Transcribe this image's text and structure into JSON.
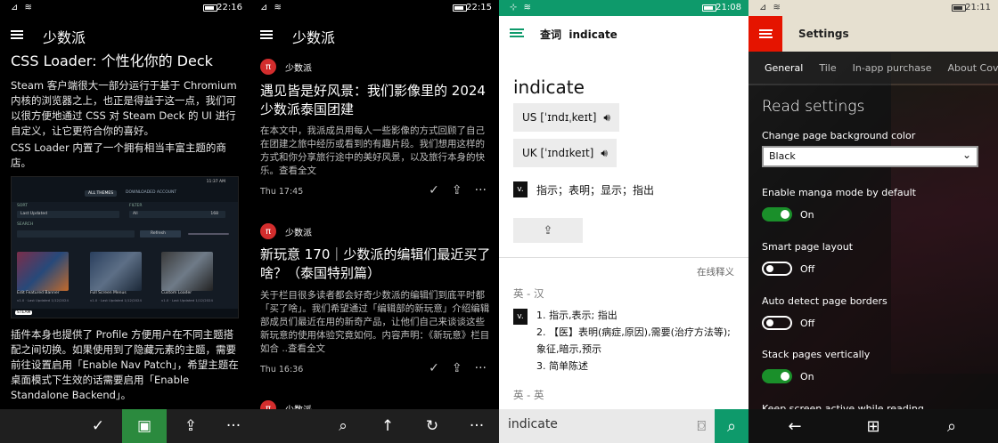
{
  "panel1": {
    "status": {
      "signal": "⊿ ≋",
      "time": "22:16"
    },
    "header": {
      "title": "少数派"
    },
    "article": {
      "title": "CSS Loader: 个性化你的 Deck",
      "p1": "Steam 客户端很大一部分运行于基于 Chromium 内核的浏览器之上，也正是得益于这一点，我们可以很方便地通过 CSS 对 Steam Deck 的 UI 进行自定义，让它更符合你的喜好。",
      "p2": "CSS Loader 内置了一个拥有相当丰富主题的商店。",
      "p3": "插件本身也提供了 Profile 方便用户在不同主题搭配之间切换。如果使用到了隐藏元素的主题，需要前往设置启用「Enable Nav Patch」，希望主题在桌面模式下生效的话需要启用「Enable Standalone Backend」。"
    },
    "screenshot": {
      "time": "11:37 AM",
      "tabs": [
        "ALL THEMES",
        "DOWNLOADED ACCOUNT"
      ],
      "sort_label": "SORT",
      "sort_value": "Last Updated",
      "filter_label": "FILTER",
      "filter_value": "All",
      "filter_count": "168",
      "search_label": "SEARCH",
      "refresh": "Refresh",
      "cards": [
        {
          "title": "Edit Featured Banner",
          "sub": "v1.0 · Last Updated 1/12/2024"
        },
        {
          "title": "Full Screen Menus",
          "sub": "v1.0 · Last Updated 1/12/2024"
        },
        {
          "title": "Custom Loader",
          "sub": "v1.0 · Last Updated 1/12/2024"
        }
      ],
      "badge": "STEAM"
    },
    "appbar": [
      "✓",
      "▣",
      "⇪",
      "···"
    ]
  },
  "panel2": {
    "status": {
      "signal": "⊿ ≋",
      "time": "22:15"
    },
    "header": {
      "title": "少数派"
    },
    "source": "少数派",
    "articles": [
      {
        "title": "遇见皆是好风景：我们影像里的 2024 少数派泰国团建",
        "summary": "在本文中，我派成员用每人一些影像的方式回顾了自己在团建之旅中经历或看到的有趣片段。我们想用这样的方式和你分享旅行途中的美好风景，以及旅行本身的快乐。查看全文",
        "time": "Thu 17:45"
      },
      {
        "title": "新玩意 170｜少数派的编辑们最近买了啥？（泰国特别篇）",
        "summary": "关于栏目很多读者都会好奇少数派的编辑们到底平时都「买了啥」。我们希望通过「编辑部的新玩意」介绍编辑部成员们最近在用的新奇产品，让他们自己来谈谈这些新玩意的使用体验究竟如何。内容声明：《新玩意》栏目如合 ..查看全文",
        "time": "Thu 16:36"
      }
    ],
    "appbar": [
      "⌕",
      "↑",
      "↻",
      "···"
    ]
  },
  "panel3": {
    "status": {
      "signal": "⊹ ≋",
      "time": "21:08"
    },
    "header": {
      "label": "查词",
      "query": "indicate"
    },
    "word": "indicate",
    "us": "US [ˈɪndɪˌkeɪt]",
    "uk": "UK [ˈɪndɪkeɪt]",
    "pos": "v.",
    "short_def": "指示；表明；显示；指出",
    "online": "在线释义",
    "sec1": "英 - 汉",
    "defs": [
      "1. 指示,表示; 指出",
      "2. 【医】表明(病症,原因),需要(治疗方法等); 象征,暗示,预示",
      "3. 简单陈述"
    ],
    "sec2": "英 - 英",
    "search_value": "indicate"
  },
  "panel4": {
    "status": {
      "signal": "⊿ ≋",
      "time": "21:11"
    },
    "title": "Settings",
    "tabs": [
      "General",
      "Tile",
      "In-app purchase",
      "About Cov"
    ],
    "section": "Read settings",
    "bg_label": "Change page background color",
    "bg_value": "Black",
    "toggles": [
      {
        "label": "Enable manga mode by default",
        "state": "On",
        "on": true
      },
      {
        "label": "Smart page layout",
        "state": "Off",
        "on": false
      },
      {
        "label": "Auto detect page borders",
        "state": "Off",
        "on": false
      },
      {
        "label": "Stack pages vertically",
        "state": "On",
        "on": true
      }
    ],
    "cut_label": "Keep screen active while reading",
    "nav": [
      "←",
      "⊞",
      "⌕"
    ]
  }
}
